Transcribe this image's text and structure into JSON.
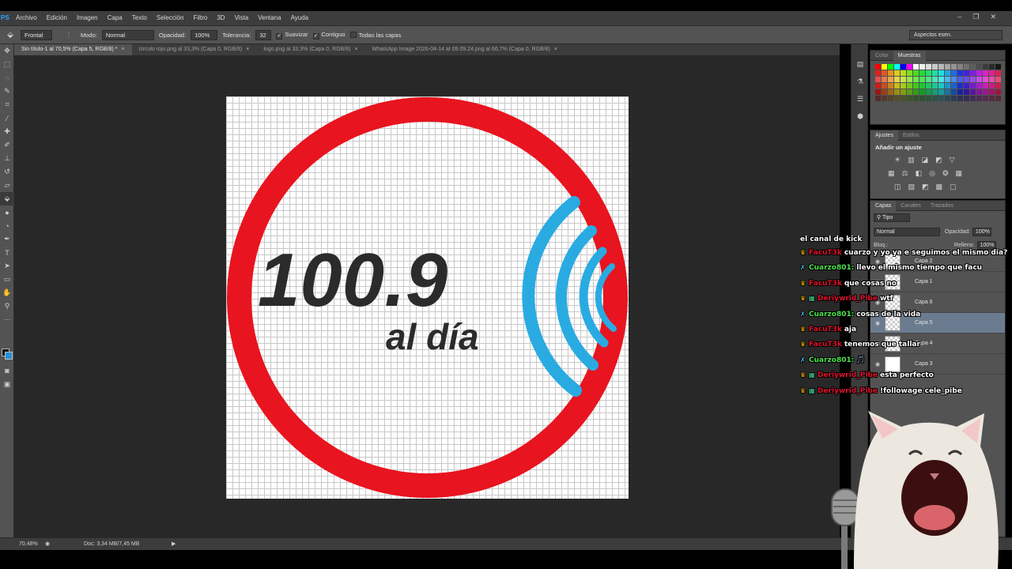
{
  "app": {
    "logo": "PS"
  },
  "menu": [
    "Archivo",
    "Edición",
    "Imagen",
    "Capa",
    "Texto",
    "Selección",
    "Filtro",
    "3D",
    "Vista",
    "Ventana",
    "Ayuda"
  ],
  "window_controls": [
    "–",
    "❐",
    "✕"
  ],
  "options": {
    "sample_label": "Frontal",
    "mode_label": "Modo:",
    "mode_value": "Normal",
    "opacity_label": "Opacidad:",
    "opacity_value": "100%",
    "tolerance_label": "Tolerancia:",
    "tolerance_value": "32",
    "smooth_label": "Suavizar",
    "contiguous_label": "Contiguo",
    "all_layers_label": "Todas las capas",
    "workspace": "Aspectos esen."
  },
  "doc_tabs": [
    {
      "label": "Sin título-1 al 70,5% (Capa 5, RGB/8) *",
      "active": true
    },
    {
      "label": "circulo rojo.png al 33,3% (Capa 0, RGB/8)",
      "active": false
    },
    {
      "label": "logo.png al 33,3% (Capa 0, RGB/8)",
      "active": false
    },
    {
      "label": "WhatsApp Image 2026-04-14 at 09.09.24.png al 66,7% (Capa 0, RGB/8)",
      "active": false
    }
  ],
  "artwork": {
    "number_text": "100.9",
    "tagline_text": "al día",
    "ring_color": "#e8141f",
    "number_color": "#2b2b2b",
    "wave_color": "#29abe2"
  },
  "status": {
    "zoom": "70,48%",
    "doc": "Doc: 3,34 MB/7,45 MB"
  },
  "swatch_panel": {
    "tabs": [
      "Color",
      "Muestras"
    ]
  },
  "adjustments_panel": {
    "tabs": [
      "Ajustes",
      "Estilos"
    ],
    "title": "Añadir un ajuste"
  },
  "layers_panel": {
    "tabs": [
      "Capas",
      "Canales",
      "Trazados"
    ],
    "filter": "Tipo",
    "blend_mode": "Normal",
    "opacity_label": "Opacidad:",
    "opacity_value": "100%",
    "lock_label": "Bloq.:",
    "fill_label": "Relleno:",
    "fill_value": "100%",
    "layers": [
      {
        "name": "Capa 2",
        "selected": false,
        "thumb": "checker"
      },
      {
        "name": "Capa 1",
        "selected": false,
        "thumb": "checker"
      },
      {
        "name": "Capa 6",
        "selected": false,
        "thumb": "checker"
      },
      {
        "name": "Capa 5",
        "selected": true,
        "thumb": "checker"
      },
      {
        "name": "Capa 4",
        "selected": false,
        "thumb": "checker"
      },
      {
        "name": "Capa 3",
        "selected": false,
        "thumb": "white"
      }
    ]
  },
  "chat": {
    "header": "el canal de kick",
    "messages": [
      {
        "badges": [
          "crown"
        ],
        "user": "FacuT3k",
        "user_color": "red",
        "text": "cuarzo y yo ya e seguimos el mismo dia?"
      },
      {
        "badges": [
          "sword"
        ],
        "user": "Cuarzo801:",
        "user_color": "green",
        "text": "llevo el mismo tiempo que facu"
      },
      {
        "badges": [
          "crown"
        ],
        "user": "FacuT3k",
        "user_color": "red",
        "text": "que cosas no"
      },
      {
        "badges": [
          "crown",
          "gift"
        ],
        "user": "Deriywrid_Pibe",
        "user_color": "red",
        "text": "wtf"
      },
      {
        "badges": [
          "sword"
        ],
        "user": "Cuarzo801:",
        "user_color": "green",
        "text": "cosas de la vida"
      },
      {
        "badges": [
          "crown"
        ],
        "user": "FacuT3k",
        "user_color": "red",
        "text": "aja"
      },
      {
        "badges": [
          "crown"
        ],
        "user": "FacuT3k",
        "user_color": "red",
        "text": "tenemos que tallar"
      },
      {
        "badges": [
          "sword"
        ],
        "user": "Cuarzo801:",
        "user_color": "green",
        "text": "🎵"
      },
      {
        "badges": [
          "crown",
          "gift"
        ],
        "user": "Deriywrid_Pibe",
        "user_color": "red",
        "text": "esta perfecto"
      },
      {
        "badges": [
          "crown",
          "gift"
        ],
        "user": "Deriywrid_Pibe",
        "user_color": "red",
        "text": "!followage cele_pibe"
      }
    ]
  },
  "overlay": {
    "cat_icon": "pop-cat-with-microphone"
  }
}
